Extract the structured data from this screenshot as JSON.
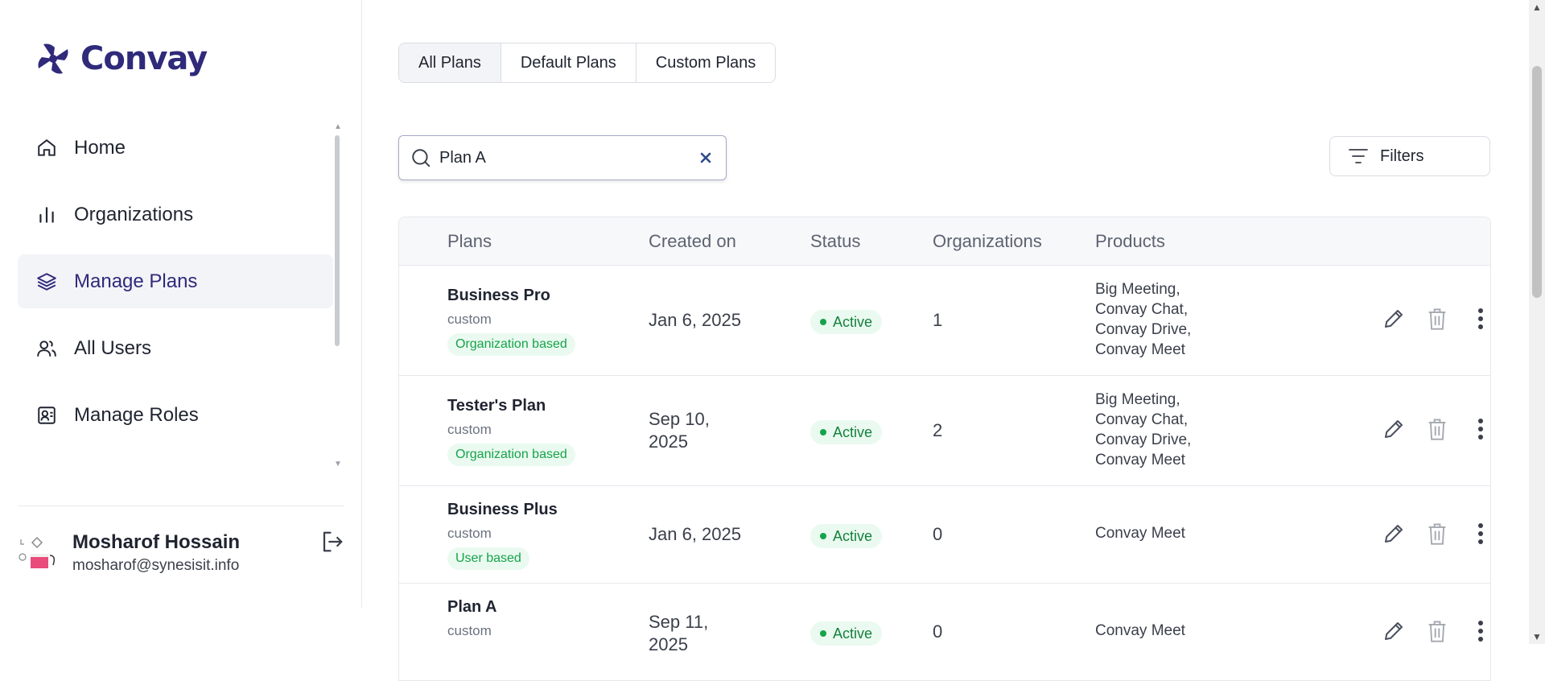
{
  "app": {
    "name": "Convay",
    "brand_color": "#2f2a7a"
  },
  "sidebar": {
    "items": [
      {
        "label": "Home",
        "icon": "home-icon",
        "active": false
      },
      {
        "label": "Organizations",
        "icon": "bar-chart-icon",
        "active": false
      },
      {
        "label": "Manage Plans",
        "icon": "layers-icon",
        "active": true
      },
      {
        "label": "All Users",
        "icon": "users-icon",
        "active": false
      },
      {
        "label": "Manage Roles",
        "icon": "id-card-icon",
        "active": false
      }
    ]
  },
  "profile": {
    "name": "Mosharof Hossain",
    "email": "mosharof@synesisit.info"
  },
  "tabs": [
    {
      "label": "All Plans",
      "active": true
    },
    {
      "label": "Default Plans",
      "active": false
    },
    {
      "label": "Custom Plans",
      "active": false
    }
  ],
  "search": {
    "value": "Plan A",
    "placeholder": ""
  },
  "filters_label": "Filters",
  "table": {
    "headers": [
      "Plans",
      "Created on",
      "Status",
      "Organizations",
      "Products"
    ],
    "rows": [
      {
        "name": "Business Pro",
        "type": "custom",
        "badge": "Organization based",
        "created": "Jan 6, 2025",
        "status": "Active",
        "orgs": "1",
        "products": [
          "Big Meeting,",
          "Convay Chat,",
          "Convay Drive,",
          "Convay Meet"
        ]
      },
      {
        "name": "Tester's Plan",
        "type": "custom",
        "badge": "Organization based",
        "created_lines": [
          "Sep 10,",
          "2025"
        ],
        "status": "Active",
        "orgs": "2",
        "products": [
          "Big Meeting,",
          "Convay Chat,",
          "Convay Drive,",
          "Convay Meet"
        ]
      },
      {
        "name": "Business Plus",
        "type": "custom",
        "badge": "User based",
        "created": "Jan 6, 2025",
        "status": "Active",
        "orgs": "0",
        "products": [
          "Convay Meet"
        ]
      },
      {
        "name": "Plan A",
        "type": "custom",
        "created_lines": [
          "Sep 11,",
          "2025"
        ],
        "status": "Active",
        "orgs": "0",
        "products": [
          "Convay Meet"
        ]
      }
    ]
  },
  "colors": {
    "active_green": "#16a34a",
    "badge_bg": "#eafaf0",
    "nav_active_bg": "#f3f4f7"
  }
}
